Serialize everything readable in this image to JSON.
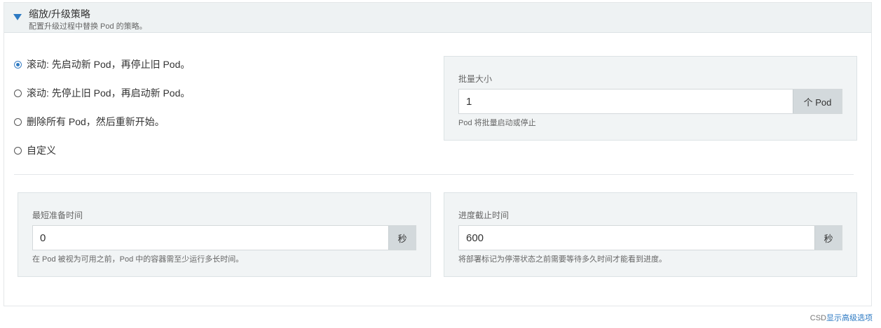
{
  "section": {
    "title": "缩放/升级策略",
    "subtitle": "配置升级过程中替换 Pod 的策略。"
  },
  "strategy_options": [
    {
      "label": "滚动: 先启动新 Pod，再停止旧 Pod。",
      "selected": true
    },
    {
      "label": "滚动: 先停止旧 Pod，再启动新 Pod。",
      "selected": false
    },
    {
      "label": "删除所有 Pod，然后重新开始。",
      "selected": false
    },
    {
      "label": "自定义",
      "selected": false
    }
  ],
  "batch_size": {
    "label": "批量大小",
    "value": "1",
    "unit": "个 Pod",
    "help": "Pod 将批量启动或停止"
  },
  "min_ready": {
    "label": "最短准备时间",
    "value": "0",
    "unit": "秒",
    "help": "在 Pod 被视为可用之前，Pod 中的容器需至少运行多长时间。"
  },
  "progress_deadline": {
    "label": "进度截止时间",
    "value": "600",
    "unit": "秒",
    "help": "将部署标记为停滞状态之前需要等待多久时间才能看到进度。"
  },
  "footer": {
    "prefix": "CSD",
    "link": "显示高级选项"
  },
  "colors": {
    "accent": "#2d7ac3",
    "header_bg": "#eef2f3",
    "box_bg": "#f1f4f5",
    "addon_bg": "#d3d9dc"
  }
}
